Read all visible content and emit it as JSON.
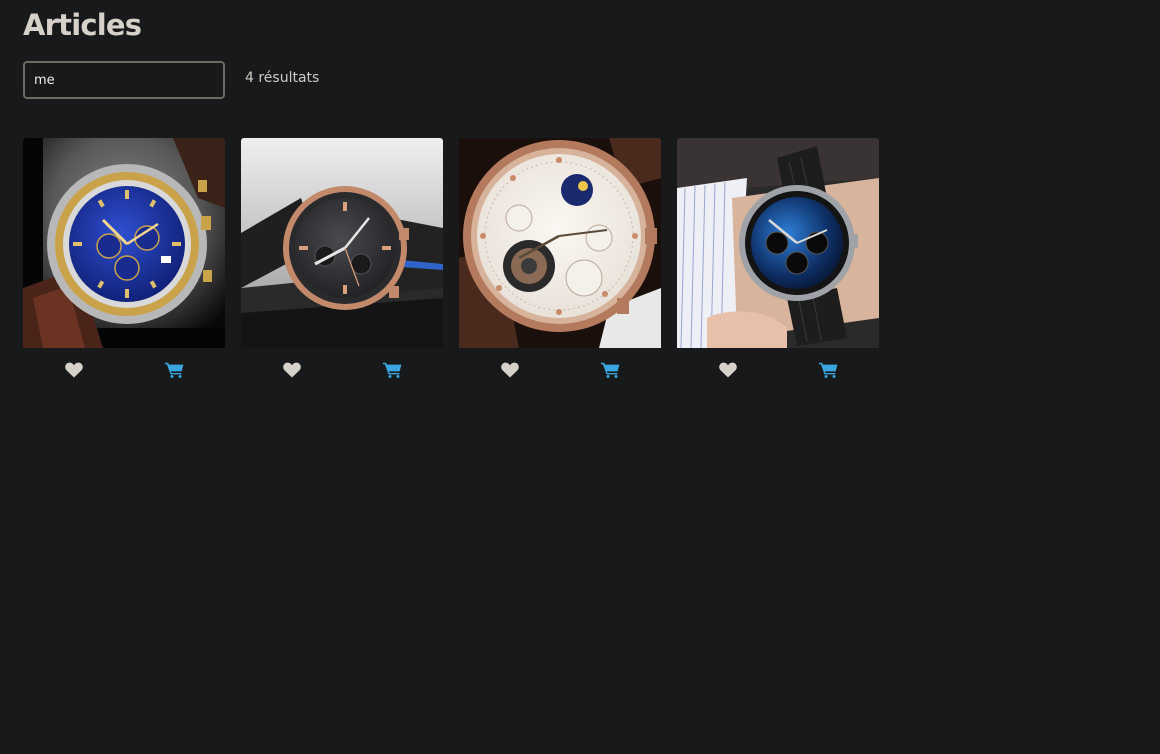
{
  "page": {
    "title": "Articles"
  },
  "search": {
    "value": "me",
    "result_count": "4 résultats"
  },
  "colors": {
    "background": "#18191b",
    "heart_icon": "#d6d1c9",
    "cart_icon": "#3aa6e0",
    "input_border": "#6e6a63"
  },
  "products": [
    {
      "image": "watch-blue-dial-gold-leather-photo",
      "favorite_icon": "heart-icon",
      "cart_icon": "cart-icon"
    },
    {
      "image": "watch-grey-dial-rose-gold-rubber-photo",
      "favorite_icon": "heart-icon",
      "cart_icon": "cart-icon"
    },
    {
      "image": "watch-skeleton-moonphase-rose-gold-photo",
      "favorite_icon": "heart-icon",
      "cart_icon": "cart-icon"
    },
    {
      "image": "watch-black-blue-mesh-on-wrist-photo",
      "favorite_icon": "heart-icon",
      "cart_icon": "cart-icon"
    }
  ]
}
